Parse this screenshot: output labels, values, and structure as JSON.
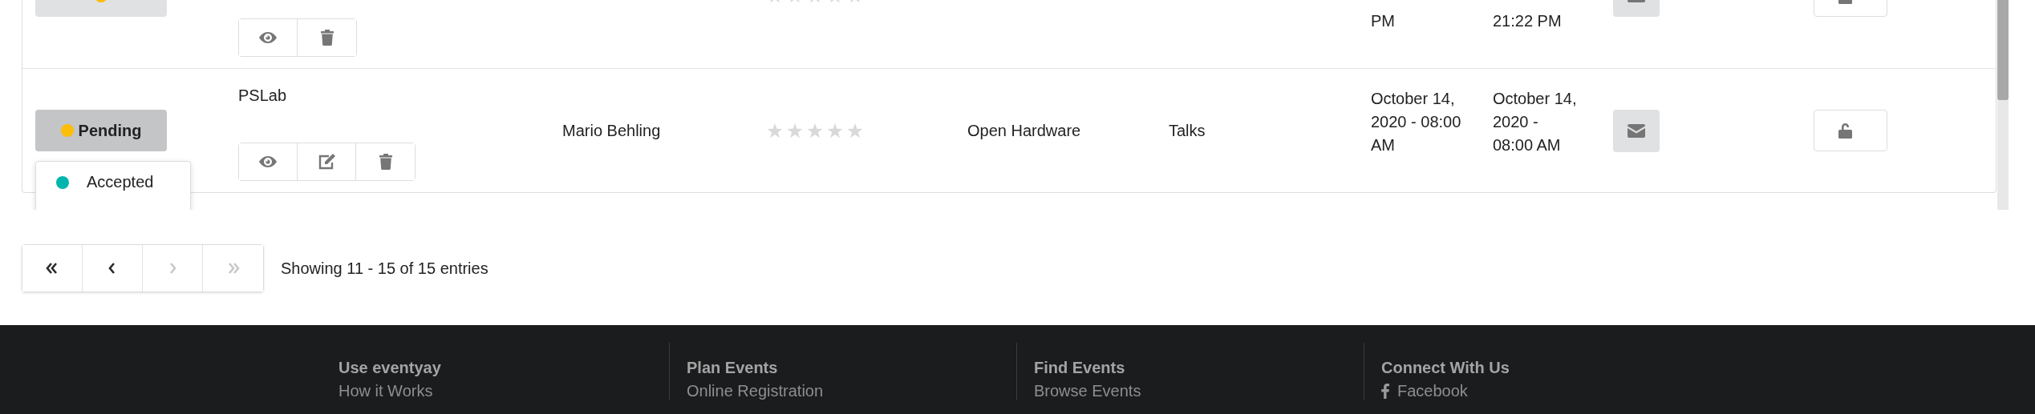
{
  "table": {
    "rows": [
      {
        "status": {
          "color": "#fbbd08",
          "expanded": false
        },
        "actions": [
          {
            "kind": "view"
          },
          {
            "kind": "delete"
          }
        ],
        "stars": 0,
        "start": "PM",
        "end": "21:22 PM"
      },
      {
        "status": {
          "label": "Pending",
          "color": "#fbbd08",
          "expanded": true,
          "menu": [
            {
              "label": "Accepted",
              "color": "#00b5ad"
            }
          ]
        },
        "title": "PSLab",
        "actions": [
          {
            "kind": "view"
          },
          {
            "kind": "edit"
          },
          {
            "kind": "delete"
          }
        ],
        "speaker": "Mario Behling",
        "stars": 0,
        "track": "Open Hardware",
        "type": "Talks",
        "start": "October 14, 2020 - 08:00 AM",
        "end": "October 14, 2020 - 08:00 AM"
      }
    ]
  },
  "pagination": {
    "buttons": [
      {
        "kind": "first",
        "disabled": false
      },
      {
        "kind": "previous",
        "disabled": false
      },
      {
        "kind": "next",
        "disabled": true
      },
      {
        "kind": "last",
        "disabled": true
      }
    ],
    "summary": "Showing 11 - 15 of 15 entries"
  },
  "footer": {
    "columns": [
      {
        "heading": "Use eventyay",
        "links": [
          {
            "label": "How it Works"
          }
        ]
      },
      {
        "heading": "Plan Events",
        "links": [
          {
            "label": "Online Registration"
          }
        ]
      },
      {
        "heading": "Find Events",
        "links": [
          {
            "label": "Browse Events"
          }
        ]
      },
      {
        "heading": "Connect With Us",
        "links": [
          {
            "label": "Facebook",
            "kind": "social"
          }
        ]
      }
    ]
  }
}
